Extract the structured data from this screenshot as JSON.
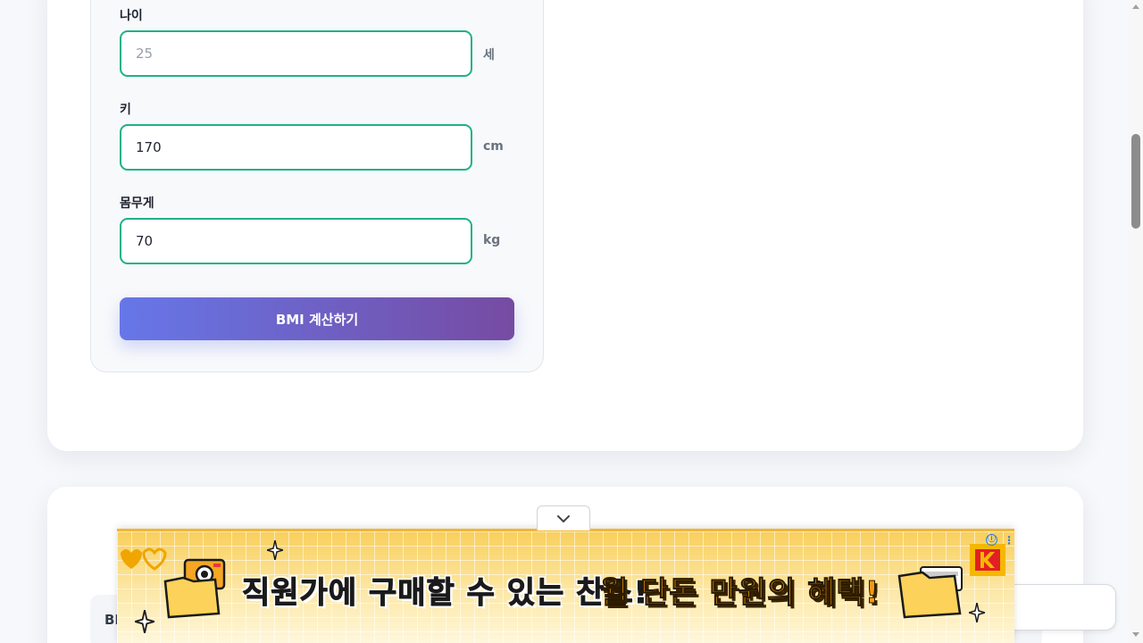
{
  "form": {
    "age": {
      "label": "나이",
      "placeholder": "25",
      "value": "",
      "unit": "세"
    },
    "height": {
      "label": "키",
      "placeholder": "",
      "value": "170",
      "unit": "cm"
    },
    "weight": {
      "label": "몸무게",
      "placeholder": "",
      "value": "70",
      "unit": "kg"
    },
    "submit_label": "BMI 계산하기"
  },
  "result": {
    "label_partial": "BI"
  },
  "ad": {
    "headline": "직원가에 구매할 수 있는 찬스!",
    "highlight": "월 단돈 만원의 혜택!",
    "info_icon": "ⓘ",
    "menu_icon": "⋮",
    "brand_letter": "K"
  },
  "icons": {
    "toggle": "chevron-down-icon",
    "camera": "camera-icon",
    "folder": "folder-icon",
    "hearts": "heart-icon",
    "sparkle": "sparkle-icon"
  },
  "colors": {
    "accent_border": "#1fb187",
    "button_gradient_start": "#6677e8",
    "button_gradient_end": "#764ba2",
    "ad_highlight": "#f39a12"
  }
}
